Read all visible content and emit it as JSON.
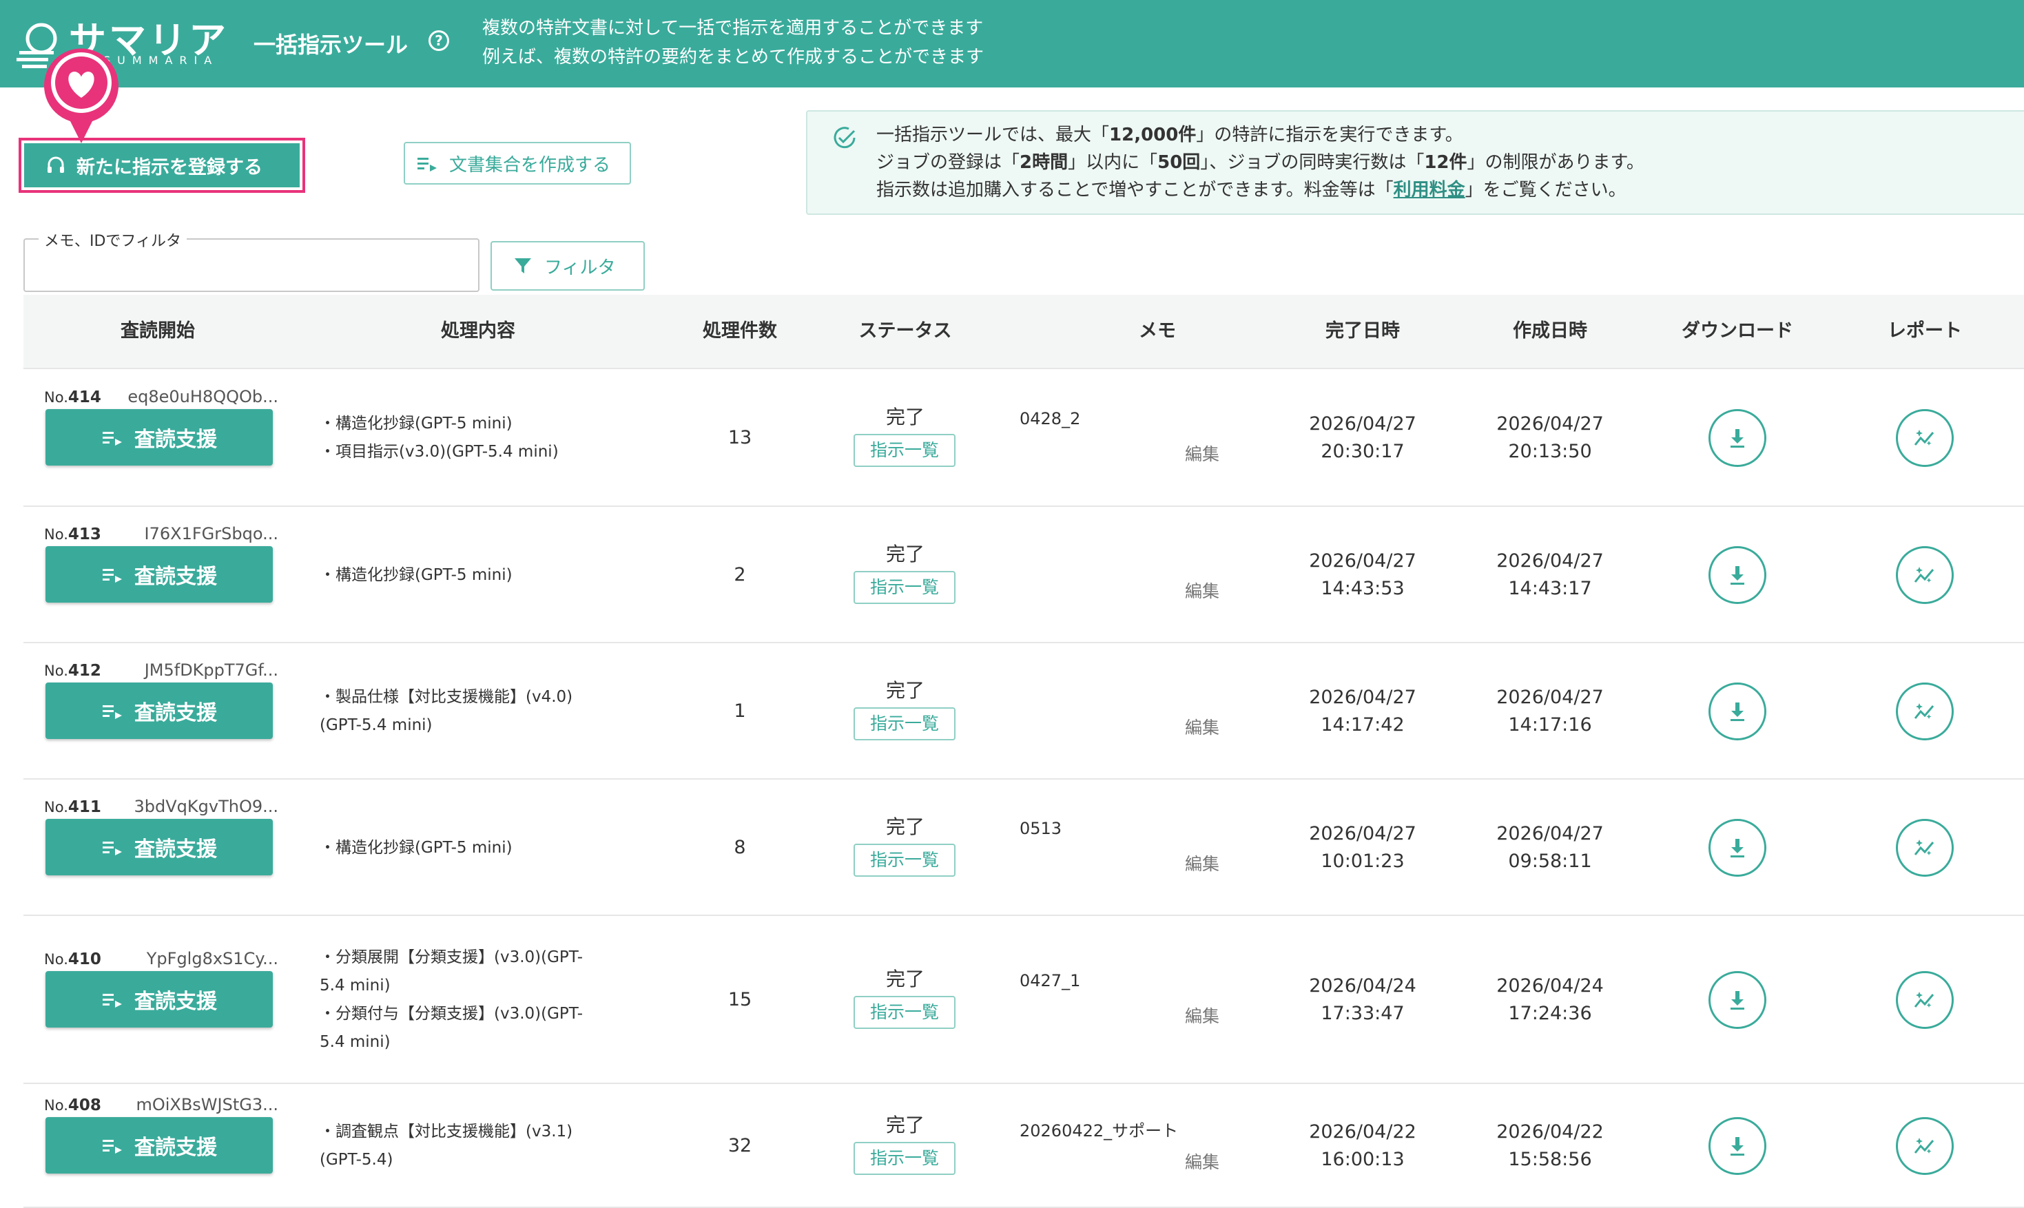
{
  "header": {
    "logo": "サマリア",
    "logo_sub": "SUMMARIA",
    "tool_title": "一括指示ツール",
    "help": "?",
    "desc_line1": "複数の特許文書に対して一括で指示を適用することができます",
    "desc_line2": "例えば、複数の特許の要約をまとめて作成することができます"
  },
  "actions": {
    "new_instruction": "新たに指示を登録する",
    "create_doc_set": "文書集合を作成する"
  },
  "notice": {
    "l1_a": "一括指示ツールでは、最大「",
    "l1_b": "12,000件",
    "l1_c": "」の特許に指示を実行できます。",
    "l2_a": "ジョブの登録は「",
    "l2_b": "2時間",
    "l2_c": "」以内に「",
    "l2_d": "50回",
    "l2_e": "」、ジョブの同時実行数は「",
    "l2_f": "12件",
    "l2_g": "」の制限があります。",
    "l3_a": "指示数は追加購入することで増やすことができます。料金等は「",
    "l3_link": "利用料金",
    "l3_c": "」をご覧ください。"
  },
  "filter": {
    "label": "メモ、IDでフィルタ",
    "value": "",
    "button": "フィルタ"
  },
  "columns": {
    "review_start": "査読開始",
    "process": "処理内容",
    "count": "処理件数",
    "status": "ステータス",
    "memo": "メモ",
    "completed": "完了日時",
    "created": "作成日時",
    "download": "ダウンロード",
    "report": "レポート"
  },
  "row_labels": {
    "review_button": "査読支援",
    "list_button": "指示一覧",
    "edit": "編集",
    "no_prefix": "No."
  },
  "rows": [
    {
      "no": "414",
      "hash": "eq8e0uH8QQOb...",
      "proc1": "・構造化抄録(GPT-5 mini)",
      "proc2": "・項目指示(v3.0)(GPT-5.4 mini)",
      "proc3": "",
      "proc4": "",
      "count": "13",
      "status": "完了",
      "memo": "0428_2",
      "done_date": "2026/04/27",
      "done_time": "20:30:17",
      "created_date": "2026/04/27",
      "created_time": "20:13:50"
    },
    {
      "no": "413",
      "hash": "I76X1FGrSbqo...",
      "proc1": "・構造化抄録(GPT-5 mini)",
      "proc2": "",
      "proc3": "",
      "proc4": "",
      "count": "2",
      "status": "完了",
      "memo": "",
      "done_date": "2026/04/27",
      "done_time": "14:43:53",
      "created_date": "2026/04/27",
      "created_time": "14:43:17"
    },
    {
      "no": "412",
      "hash": "JM5fDKppT7Gf...",
      "proc1": "・製品仕様【対比支援機能】(v4.0)",
      "proc2": "(GPT-5.4 mini)",
      "proc3": "",
      "proc4": "",
      "count": "1",
      "status": "完了",
      "memo": "",
      "done_date": "2026/04/27",
      "done_time": "14:17:42",
      "created_date": "2026/04/27",
      "created_time": "14:17:16"
    },
    {
      "no": "411",
      "hash": "3bdVqKgvThO9...",
      "proc1": "・構造化抄録(GPT-5 mini)",
      "proc2": "",
      "proc3": "",
      "proc4": "",
      "count": "8",
      "status": "完了",
      "memo": "0513",
      "done_date": "2026/04/27",
      "done_time": "10:01:23",
      "created_date": "2026/04/27",
      "created_time": "09:58:11"
    },
    {
      "no": "410",
      "hash": "YpFglg8xS1Cy...",
      "proc1": "・分類展開【分類支援】(v3.0)(GPT-",
      "proc2": "5.4 mini)",
      "proc3": "・分類付与【分類支援】(v3.0)(GPT-",
      "proc4": "5.4 mini)",
      "count": "15",
      "status": "完了",
      "memo": "0427_1",
      "done_date": "2026/04/24",
      "done_time": "17:33:47",
      "created_date": "2026/04/24",
      "created_time": "17:24:36"
    },
    {
      "no": "408",
      "hash": "mOiXBsWJStG3...",
      "proc1": "・調査観点【対比支援機能】(v3.1)",
      "proc2": "(GPT-5.4)",
      "proc3": "",
      "proc4": "",
      "count": "32",
      "status": "完了",
      "memo": "20260422_サポート",
      "done_date": "2026/04/22",
      "done_time": "16:00:13",
      "created_date": "2026/04/22",
      "created_time": "15:58:56"
    }
  ],
  "icons": {
    "help": "question-circle-icon",
    "heart": "heart-pin-icon",
    "new": "headset-icon",
    "docset": "list-play-icon",
    "filter": "funnel-icon",
    "check": "check-circle-icon",
    "download": "download-icon",
    "report": "sparkle-chart-icon"
  },
  "colors": {
    "primary": "#3aab9b",
    "highlight": "#e8337a",
    "notice_bg": "#eef8f5"
  }
}
